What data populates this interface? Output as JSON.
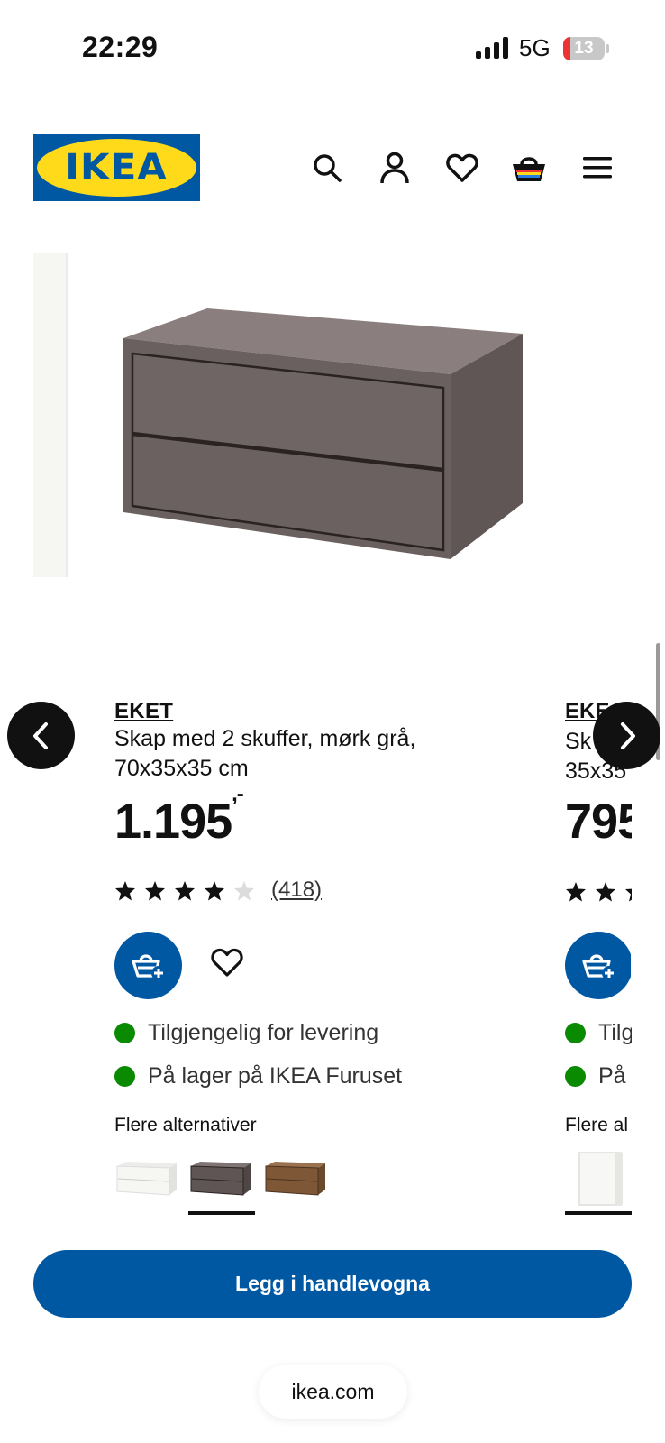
{
  "status_bar": {
    "time": "22:29",
    "network": "5G",
    "battery": "13"
  },
  "header": {
    "logo_text": "IKEA",
    "icons": [
      "search-icon",
      "account-icon",
      "heart-icon",
      "cart-icon",
      "menu-icon"
    ]
  },
  "product": {
    "brand": "EKET",
    "description": "Skap med 2 skuffer, mørk grå, 70x35x35 cm",
    "price": "1.195",
    "price_suffix": ",-",
    "rating": 4,
    "rating_max": 5,
    "review_count": "(418)",
    "availability": [
      "Tilgjengelig for levering",
      "På lager på IKEA Furuset"
    ],
    "alternatives_label": "Flere alternativer",
    "alternatives": [
      {
        "name": "white",
        "color": "#f3f3f0"
      },
      {
        "name": "dark-grey",
        "color": "#5a5150"
      },
      {
        "name": "walnut",
        "color": "#7a5535"
      }
    ],
    "selected_alternative": 1
  },
  "next_product": {
    "brand": "EKE",
    "desc_line1": "Sk",
    "desc_line2": "35x35",
    "price": "795",
    "availability": [
      "Tilg",
      "På"
    ],
    "alternatives_label": "Flere al"
  },
  "colors": {
    "ikea_blue": "#0058a3",
    "ikea_yellow": "#ffda1a",
    "stock_green": "#0a8a00"
  },
  "add_to_cart_label": "Legg i handlevogna",
  "url": "ikea.com"
}
